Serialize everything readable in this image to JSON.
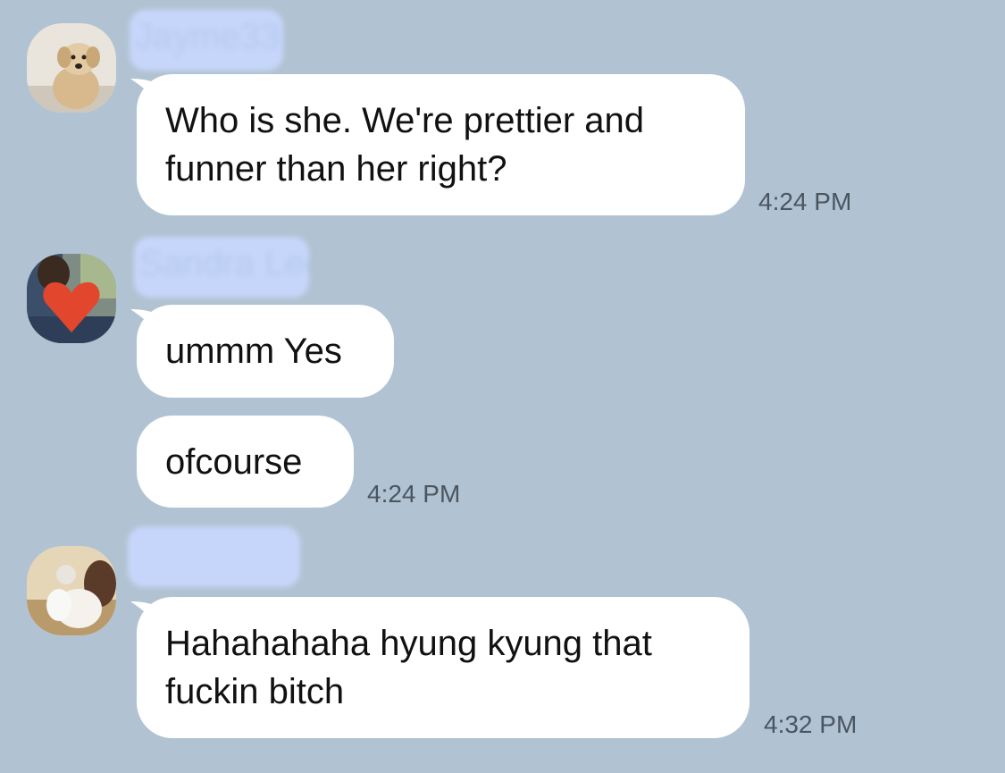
{
  "theme": {
    "background": "#b1c3d2",
    "bubble": "#ffffff",
    "name_blur": "#c6d6fa",
    "timestamp_color": "#4b5560"
  },
  "messages": [
    {
      "sender": "Jayme33",
      "avatar_icon": "dog-avatar",
      "lines": [
        "Who is she. We're prettier and",
        "funner than her right?"
      ],
      "time": "4:24 PM"
    },
    {
      "sender": "Sandra Lee",
      "avatar_icon": "heart-covered-photo-avatar",
      "bubbles": [
        "ummm Yes",
        "ofcourse"
      ],
      "time": "4:24 PM"
    },
    {
      "sender": "",
      "avatar_icon": "mother-and-child-avatar",
      "lines": [
        "Hahahahaha hyung kyung that",
        "fuckin bitch"
      ],
      "time": "4:32 PM"
    }
  ]
}
